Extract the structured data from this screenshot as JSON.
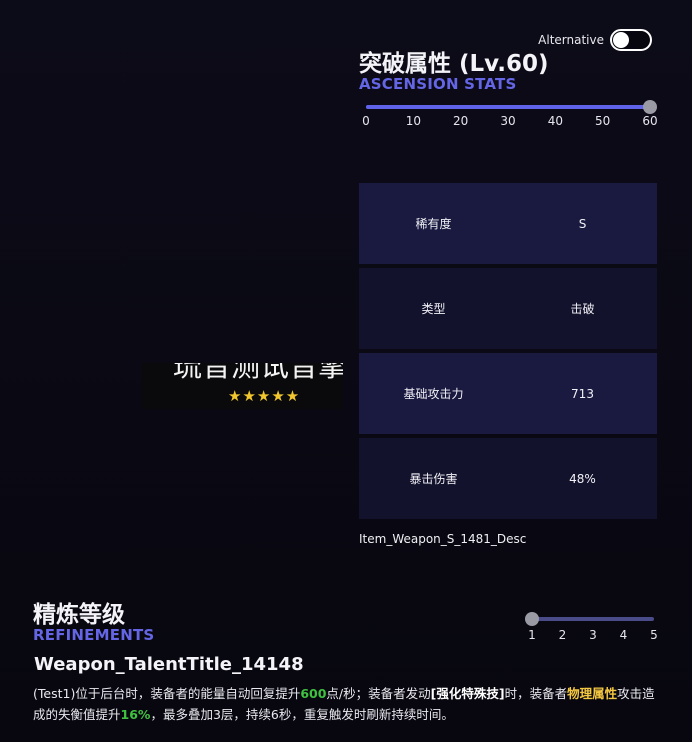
{
  "alternative_toggle": {
    "label": "Alternative",
    "on": false
  },
  "ascension": {
    "title": "突破属性 (Lv.60)",
    "subtitle": "ASCENSION STATS",
    "ticks": [
      "0",
      "10",
      "20",
      "30",
      "40",
      "50",
      "60"
    ],
    "value": 60
  },
  "stats": [
    {
      "label": "稀有度",
      "value": "S"
    },
    {
      "label": "类型",
      "value": "击破"
    },
    {
      "label": "基础攻击力",
      "value": "713"
    },
    {
      "label": "暴击伤害",
      "value": "48%"
    }
  ],
  "description_id": "Item_Weapon_S_1481_Desc",
  "weapon": {
    "name": "琉音测试音擎",
    "stars": "★★★★★"
  },
  "refinements": {
    "title": "精炼等级",
    "subtitle": "REFINEMENTS",
    "ticks": [
      "1",
      "2",
      "3",
      "4",
      "5"
    ],
    "value": 1
  },
  "talent": {
    "title": "Weapon_TalentTitle_14148",
    "desc_parts": [
      {
        "text": "(Test1)位于后台时，装备者的能量自动回复提升",
        "style": ""
      },
      {
        "text": "600",
        "style": "green"
      },
      {
        "text": "点/秒；装备者发动",
        "style": ""
      },
      {
        "text": "[强化特殊技]",
        "style": "white"
      },
      {
        "text": "时，装备者",
        "style": ""
      },
      {
        "text": "物理属性",
        "style": "yellow"
      },
      {
        "text": "攻击造成的失衡值提升",
        "style": ""
      },
      {
        "text": "16%",
        "style": "green"
      },
      {
        "text": "，最多叠加3层，持续6秒，重复触发时刷新持续时间。",
        "style": ""
      }
    ]
  },
  "colors": {
    "accent": "#5f63e9",
    "subtitle": "#6466e6",
    "highlight_green": "#3fc23f",
    "highlight_yellow": "#f5c842",
    "star": "#f2c62e"
  }
}
